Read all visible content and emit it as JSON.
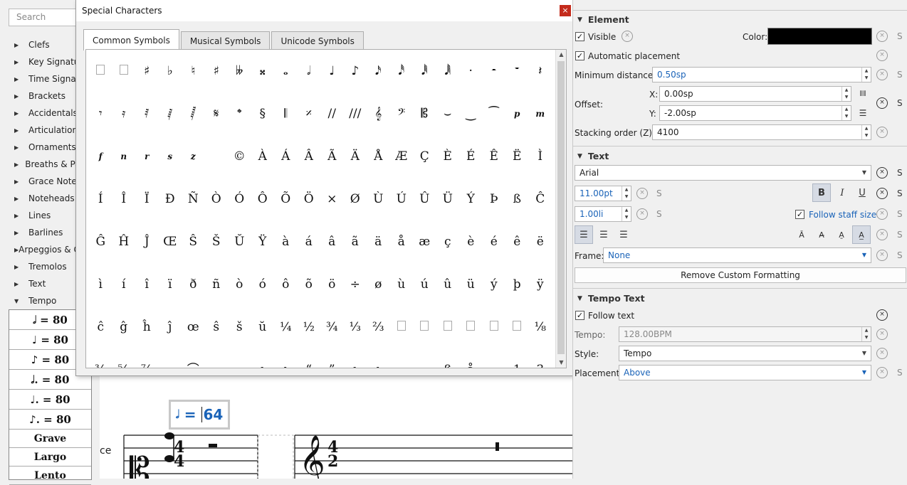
{
  "palette": {
    "search_placeholder": "Search",
    "items": [
      {
        "label": "Clefs",
        "expanded": false
      },
      {
        "label": "Key Signatures",
        "expanded": false
      },
      {
        "label": "Time Signatures",
        "expanded": false
      },
      {
        "label": "Brackets",
        "expanded": false
      },
      {
        "label": "Accidentals",
        "expanded": false
      },
      {
        "label": "Articulations",
        "expanded": false
      },
      {
        "label": "Ornaments",
        "expanded": false
      },
      {
        "label": "Breaths & Pauses",
        "expanded": false
      },
      {
        "label": "Grace Notes",
        "expanded": false
      },
      {
        "label": "Noteheads",
        "expanded": false
      },
      {
        "label": "Lines",
        "expanded": false
      },
      {
        "label": "Barlines",
        "expanded": false
      },
      {
        "label": "Arpeggios & Glissandos",
        "expanded": false
      },
      {
        "label": "Tremolos",
        "expanded": false
      },
      {
        "label": "Text",
        "expanded": false
      },
      {
        "label": "Tempo",
        "expanded": true
      }
    ],
    "tempo_cells": [
      "𝅗𝅥 = 80",
      "♩ = 80",
      "♪ = 80",
      "𝅗𝅥. = 80",
      "♩. = 80",
      "♪. = 80",
      "Grave",
      "Largo",
      "Lento"
    ]
  },
  "dialog": {
    "title": "Special Characters",
    "close_glyph": "×",
    "tabs": [
      "Common Symbols",
      "Musical Symbols",
      "Unicode Symbols"
    ],
    "active_tab": "Common Symbols",
    "rows": [
      [
        "□",
        "□",
        "♯",
        "♭",
        "♮",
        "♯",
        "𝄫",
        "𝄪",
        "𝅝",
        "𝅗𝅥",
        "♩",
        "♪",
        "𝅘𝅥𝅯",
        "𝅘𝅥𝅰",
        "𝅘𝅥𝅱",
        "𝅘𝅥𝅲",
        "·",
        "𝄼",
        "𝄻",
        "𝄽"
      ],
      [
        "𝄾",
        "𝄿",
        "𝅀",
        "𝅁",
        "𝅂",
        "𝄋",
        "𝄌",
        "§",
        "𝄃",
        "𝄎",
        "//",
        "///",
        "𝄞",
        "𝄢",
        "𝄡",
        "⌣",
        "‿",
        "⁀",
        "p",
        "m"
      ],
      [
        "f",
        "n",
        "r",
        "s",
        "z",
        " ",
        "©",
        "À",
        "Á",
        "Â",
        "Ã",
        "Ä",
        "Å",
        "Æ",
        "Ç",
        "È",
        "É",
        "Ê",
        "Ë",
        "Ì"
      ],
      [
        "Í",
        "Î",
        "Ï",
        "Ð",
        "Ñ",
        "Ò",
        "Ó",
        "Ô",
        "Õ",
        "Ö",
        "×",
        "Ø",
        "Ù",
        "Ú",
        "Û",
        "Ü",
        "Ý",
        "Þ",
        "ß",
        "Ĉ"
      ],
      [
        "Ĝ",
        "Ĥ",
        "Ĵ",
        "Œ",
        "Ŝ",
        "Š",
        "Ŭ",
        "Ÿ",
        "à",
        "á",
        "â",
        "ã",
        "ä",
        "å",
        "æ",
        "ç",
        "è",
        "é",
        "ê",
        "ë"
      ],
      [
        "ì",
        "í",
        "î",
        "ï",
        "ð",
        "ñ",
        "ò",
        "ó",
        "ô",
        "õ",
        "ö",
        "÷",
        "ø",
        "ù",
        "ú",
        "û",
        "ü",
        "ý",
        "þ",
        "ÿ"
      ],
      [
        "ĉ",
        "ĝ",
        "ĥ",
        "ĵ",
        "œ",
        "ŝ",
        "š",
        "ŭ",
        "¼",
        "½",
        "¾",
        "⅓",
        "⅔",
        "□",
        "□",
        "□",
        "□",
        "□",
        "□",
        "⅛"
      ],
      [
        "¾",
        "⅝",
        "⅞",
        " ",
        "⌒",
        " ",
        " ",
        "ı",
        "ı",
        "“",
        "”",
        "ı",
        "ı",
        " ",
        " ",
        "ß",
        "å",
        "·",
        "1",
        "3"
      ]
    ]
  },
  "score": {
    "tempo_edit": {
      "glyph": "𝅗𝅥",
      "eq": " = ",
      "pre": "",
      "post": "64"
    },
    "staff_label": "ce"
  },
  "properties": {
    "element": {
      "title": "Element",
      "visible_label": "Visible",
      "color_label": "Color:",
      "color_value": "#000000",
      "auto_placement_label": "Automatic placement",
      "min_distance_label": "Minimum distance:",
      "min_distance_value": "0.50sp",
      "offset_label": "Offset:",
      "x_label": "X:",
      "x_value": "0.00sp",
      "y_label": "Y:",
      "y_value": "-2.00sp",
      "stacking_label": "Stacking order (Z):",
      "stacking_value": "4100"
    },
    "text": {
      "title": "Text",
      "font": "Arial",
      "size_value": "11.00pt",
      "spacing_value": "1.00li",
      "follow_staff_label": "Follow staff size",
      "frame_label": "Frame:",
      "frame_value": "None",
      "remove_label": "Remove Custom Formatting",
      "bold": "B",
      "italic": "I",
      "underline": "U"
    },
    "tempo_text": {
      "title": "Tempo Text",
      "follow_label": "Follow text",
      "tempo_label": "Tempo:",
      "tempo_value": "128.00BPM",
      "style_label": "Style:",
      "style_value": "Tempo",
      "placement_label": "Placement:",
      "placement_value": "Above"
    },
    "s_label": "S",
    "check_glyph": "✓"
  }
}
